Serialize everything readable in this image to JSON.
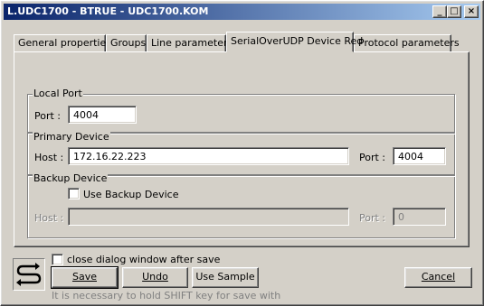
{
  "window": {
    "title": "L.UDC1700 - BTRUE - UDC1700.KOM",
    "minimize_label": "_",
    "maximize_label": "□",
    "close_label": "×"
  },
  "tabs": [
    {
      "label": "General properties"
    },
    {
      "label": "Groups"
    },
    {
      "label": "Line parameters"
    },
    {
      "label": "SerialOverUDP Device Red",
      "active": true
    },
    {
      "label": "Protocol parameters"
    }
  ],
  "local_port": {
    "group_title": "Local Port",
    "port_label": "Port :",
    "port_value": "4004"
  },
  "primary_device": {
    "group_title": "Primary Device",
    "host_label": "Host :",
    "host_value": "172.16.22.223",
    "port_label": "Port :",
    "port_value": "4004"
  },
  "backup_device": {
    "group_title": "Backup Device",
    "use_backup_label": "Use Backup Device",
    "use_backup_checked": false,
    "host_label": "Host :",
    "host_value": "",
    "port_label": "Port :",
    "port_value": "0"
  },
  "footer": {
    "close_after_save_label": "close dialog window after save",
    "close_after_save_checked": false,
    "save_label": "Save",
    "undo_label": "Undo",
    "use_sample_label": "Use Sample",
    "cancel_label": "Cancel",
    "hint": "It is necessary to hold SHIFT key for save with"
  },
  "colors": {
    "face": "#d4d0c8",
    "title_start": "#0a246a",
    "title_end": "#a6caf0",
    "logo_arrow": "#000000"
  },
  "icons": {
    "logo": "transfer-arrows-icon"
  }
}
